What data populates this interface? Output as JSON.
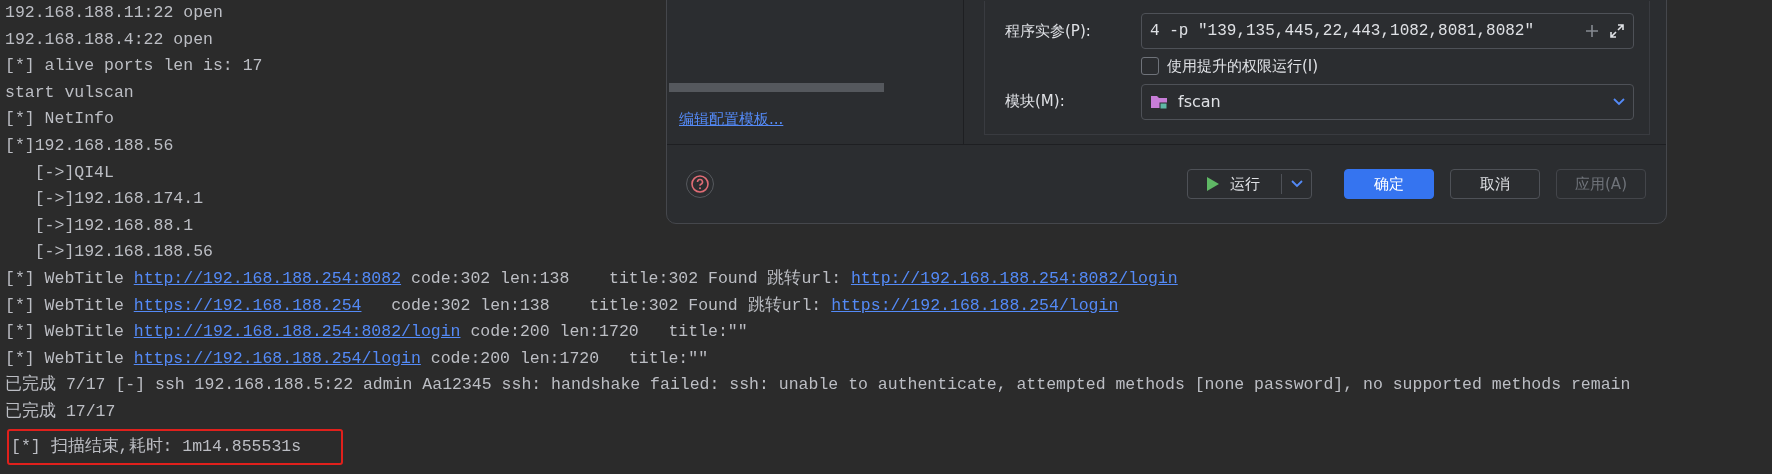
{
  "console": {
    "lines": [
      {
        "segments": [
          {
            "kind": "text",
            "text": "192.168.188.11:22 open"
          }
        ]
      },
      {
        "segments": [
          {
            "kind": "text",
            "text": "192.168.188.4:22 open"
          }
        ]
      },
      {
        "segments": [
          {
            "kind": "text",
            "text": "[*] alive ports len is: 17"
          }
        ]
      },
      {
        "segments": [
          {
            "kind": "text",
            "text": "start vulscan"
          }
        ]
      },
      {
        "segments": [
          {
            "kind": "text",
            "text": "[*] NetInfo"
          }
        ]
      },
      {
        "segments": [
          {
            "kind": "text",
            "text": "[*]192.168.188.56"
          }
        ]
      },
      {
        "segments": [
          {
            "kind": "text",
            "text": "   [->]QI4L"
          }
        ]
      },
      {
        "segments": [
          {
            "kind": "text",
            "text": "   [->]192.168.174.1"
          }
        ]
      },
      {
        "segments": [
          {
            "kind": "text",
            "text": "   [->]192.168.88.1"
          }
        ]
      },
      {
        "segments": [
          {
            "kind": "text",
            "text": "   [->]192.168.188.56"
          }
        ]
      },
      {
        "segments": [
          {
            "kind": "text",
            "text": "[*] WebTitle "
          },
          {
            "kind": "link",
            "text": "http://192.168.188.254:8082"
          },
          {
            "kind": "text",
            "text": " code:302 len:138    title:302 Found 跳转url: "
          },
          {
            "kind": "link",
            "text": "http://192.168.188.254:8082/login"
          }
        ]
      },
      {
        "segments": [
          {
            "kind": "text",
            "text": "[*] WebTitle "
          },
          {
            "kind": "link",
            "text": "https://192.168.188.254"
          },
          {
            "kind": "text",
            "text": "   code:302 len:138    title:302 Found 跳转url: "
          },
          {
            "kind": "link",
            "text": "https://192.168.188.254/login"
          }
        ]
      },
      {
        "segments": [
          {
            "kind": "text",
            "text": "[*] WebTitle "
          },
          {
            "kind": "link",
            "text": "http://192.168.188.254:8082/login"
          },
          {
            "kind": "text",
            "text": " code:200 len:1720   title:\"\""
          }
        ]
      },
      {
        "segments": [
          {
            "kind": "text",
            "text": "[*] WebTitle "
          },
          {
            "kind": "link",
            "text": "https://192.168.188.254/login"
          },
          {
            "kind": "text",
            "text": " code:200 len:1720   title:\"\""
          }
        ]
      },
      {
        "segments": [
          {
            "kind": "text",
            "text": "已完成 7/17 [-] ssh 192.168.188.5:22 admin Aa12345 ssh: handshake failed: ssh: unable to authenticate, attempted methods [none password], no supported methods remain"
          }
        ]
      },
      {
        "segments": [
          {
            "kind": "text",
            "text": "已完成 17/17"
          }
        ]
      },
      {
        "highlighted": true,
        "segments": [
          {
            "kind": "text",
            "text": "[*] 扫描结束,耗时: 1m14.855531s"
          }
        ]
      }
    ]
  },
  "dialog": {
    "edit_templates_link": "编辑配置模板...",
    "program_args": {
      "label": "程序实参(P):",
      "value": "4 -p \"139,135,445,22,443,1082,8081,8082\""
    },
    "elevated": {
      "label": "使用提升的权限运行(I)",
      "checked": false
    },
    "module": {
      "label": "模块(M):",
      "value": "fscan"
    },
    "buttons": [
      {
        "label": "运行",
        "kind": "run",
        "disabled": false
      },
      {
        "label": "确定",
        "kind": "primary",
        "disabled": false
      },
      {
        "label": "取消",
        "kind": "secondary",
        "disabled": false
      },
      {
        "label": "应用(A)",
        "kind": "secondary",
        "disabled": true
      }
    ]
  }
}
